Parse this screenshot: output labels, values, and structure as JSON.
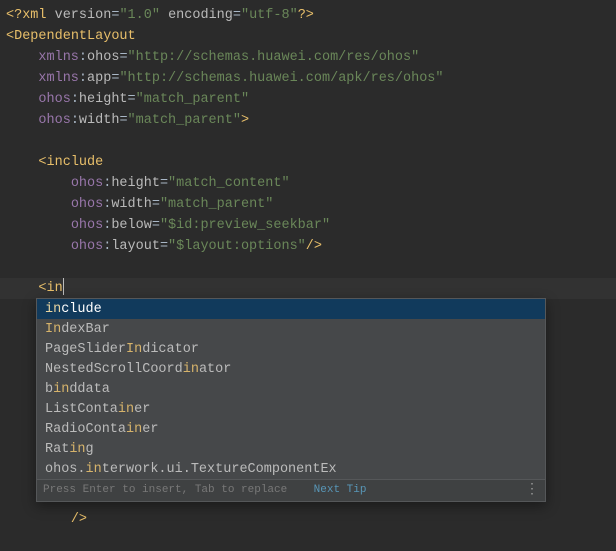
{
  "code": {
    "xml_decl": {
      "version_key": "version",
      "version_val": "\"1.0\"",
      "encoding_key": "encoding",
      "encoding_val": "\"utf-8\""
    },
    "root_tag": "DependentLayout",
    "root_attrs": [
      {
        "ns": "xmlns",
        "name": "ohos",
        "val": "\"http://schemas.huawei.com/res/ohos\""
      },
      {
        "ns": "xmlns",
        "name": "app",
        "val": "\"http://schemas.huawei.com/apk/res/ohos\""
      },
      {
        "ns": "ohos",
        "name": "height",
        "val": "\"match_parent\""
      },
      {
        "ns": "ohos",
        "name": "width",
        "val": "\"match_parent\""
      }
    ],
    "include_tag": "include",
    "include_attrs": [
      {
        "ns": "ohos",
        "name": "height",
        "val": "\"match_content\""
      },
      {
        "ns": "ohos",
        "name": "width",
        "val": "\"match_parent\""
      },
      {
        "ns": "ohos",
        "name": "below",
        "val": "\"$id:preview_seekbar\""
      },
      {
        "ns": "ohos",
        "name": "layout",
        "val": "\"$layout:options\""
      }
    ],
    "typed": "in",
    "tail_close": "/>"
  },
  "popup": {
    "items": [
      {
        "pre": "",
        "hl": "in",
        "post": "clude"
      },
      {
        "pre": "",
        "hl": "In",
        "post": "dexBar"
      },
      {
        "pre": "PageSlider",
        "hl": "In",
        "post": "dicator"
      },
      {
        "pre": "NestedScrollCoord",
        "hl": "in",
        "post": "ator"
      },
      {
        "pre": "b",
        "hl": "in",
        "post": "ddata"
      },
      {
        "pre": "ListConta",
        "hl": "in",
        "post": "er"
      },
      {
        "pre": "RadioConta",
        "hl": "in",
        "post": "er"
      },
      {
        "pre": "Rat",
        "hl": "in",
        "post": "g"
      },
      {
        "pre": "ohos.",
        "hl": "in",
        "post": "terwork.ui.TextureComponentEx"
      }
    ],
    "footer_hint": "Press Enter to insert, Tab to replace",
    "next_tip": "Next Tip"
  }
}
